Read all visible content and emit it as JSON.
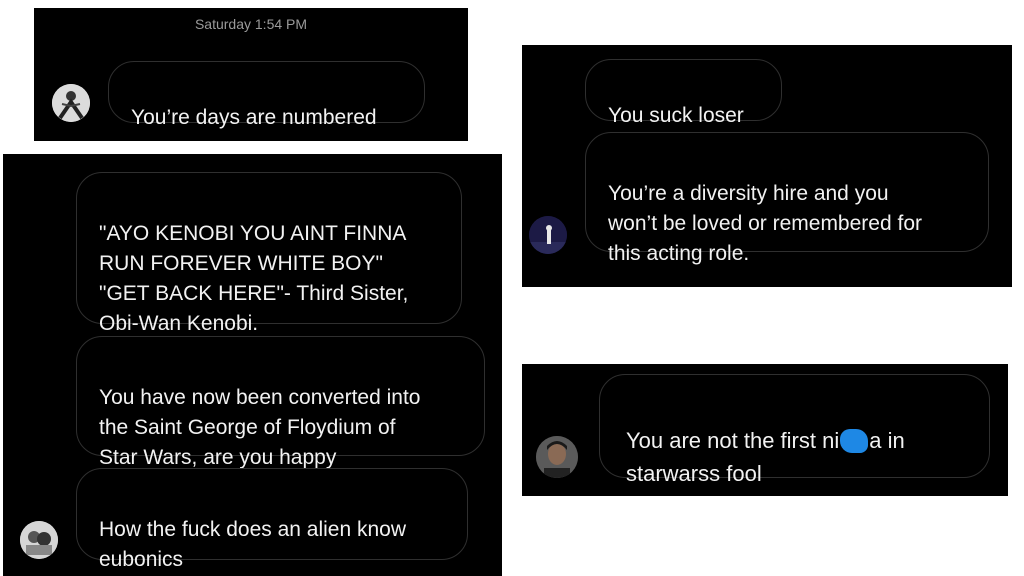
{
  "panel1": {
    "timestamp": "Saturday 1:54 PM",
    "message": "You’re days are numbered"
  },
  "panel2": {
    "messages": [
      "\"AYO KENOBI YOU AINT FINNA\nRUN FOREVER WHITE BOY\"\n\"GET BACK HERE\"- Third Sister,\nObi-Wan Kenobi.",
      "You have now been converted into\nthe Saint George of Floydium of\nStar Wars, are you happy",
      "How the fuck does an alien know\neubonics"
    ]
  },
  "panel3": {
    "messages": [
      "You suck loser",
      "You’re a diversity hire and you\nwon’t be loved or remembered for\nthis acting role."
    ]
  },
  "panel4": {
    "message_part1": "You are not the first ni",
    "message_part2": "a in\nstarwarss fool"
  },
  "colors": {
    "background": "#000000",
    "bubble_border": "#2f2f2f",
    "text": "#f2f2f2",
    "censor_blob": "#1e88e5"
  }
}
